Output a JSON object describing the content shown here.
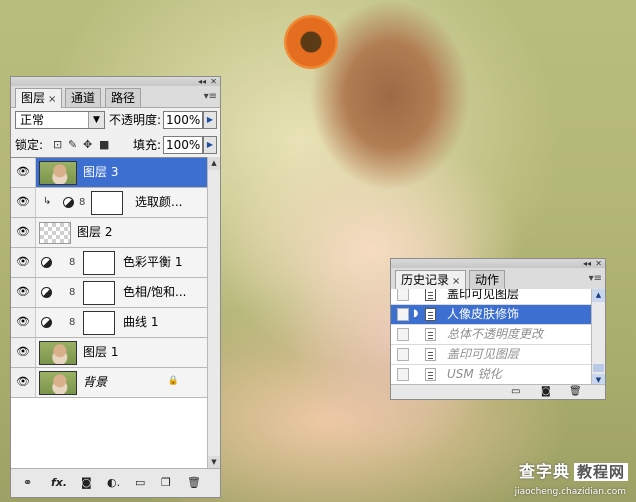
{
  "layers_panel": {
    "tabs": [
      {
        "label": "图层",
        "close": "×"
      },
      {
        "label": "通道"
      },
      {
        "label": "路径"
      }
    ],
    "blend_mode": "正常",
    "opacity_label": "不透明度:",
    "opacity_value": "100%",
    "lock_label": "锁定:",
    "fill_label": "填充:",
    "fill_value": "100%",
    "layers": [
      {
        "name": "图层 3",
        "selected": true
      },
      {
        "name": "选取颜..."
      },
      {
        "name": "图层 2"
      },
      {
        "name": "色彩平衡 1"
      },
      {
        "name": "色相/饱和..."
      },
      {
        "name": "曲线 1"
      },
      {
        "name": "图层 1"
      },
      {
        "name": "背景"
      }
    ]
  },
  "history_panel": {
    "tabs": [
      {
        "label": "历史记录",
        "close": "×"
      },
      {
        "label": "动作"
      }
    ],
    "items": [
      {
        "label": "盖印可见图层"
      },
      {
        "label": "人像皮肤修饰",
        "selected": true
      },
      {
        "label": "总体不透明度更改"
      },
      {
        "label": "盖印可见图层"
      },
      {
        "label": "USM 锐化"
      }
    ]
  },
  "watermark": {
    "text": "查字典",
    "box": "教程网",
    "url": "jiaocheng.chazidian.com"
  },
  "colors": {
    "selection": "#3d6fd1",
    "panel_bg": "#f0f0f0"
  }
}
